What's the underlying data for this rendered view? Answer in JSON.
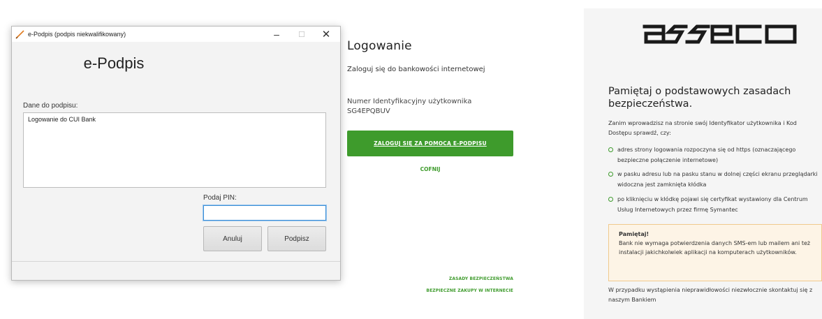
{
  "dialog": {
    "window_title": "e-Podpis (podpis niekwalifikowany)",
    "controls": {
      "minimize": "–",
      "maximize": "☐",
      "close": "✕"
    },
    "heading": "e-Podpis",
    "data_label": "Dane do podpisu:",
    "data_value": "Logowanie do CUI Bank",
    "pin_label": "Podaj PIN:",
    "pin_value": "",
    "cancel_label": "Anuluj",
    "sign_label": "Podpisz"
  },
  "login": {
    "title": "Logowanie",
    "subtitle": "Zaloguj się do bankowości internetowej",
    "user_id_label": "Numer Identyfikacyjny użytkownika",
    "user_id_value": "SG4EPQBUV",
    "login_button": "ZALOGUJ SIĘ ZA POMOCĄ E-PODPISU",
    "back_link": "COFNIJ",
    "footer_links": [
      "ZASADY BEZPIECZEŃSTWA",
      "BEZPIECZNE ZAKUPY W INTERNECIE"
    ]
  },
  "info": {
    "logo_text": "asseco",
    "heading": "Pamiętaj o podstawowych zasadach bezpieczeństwa.",
    "intro": "Zanim wprowadzisz na stronie swój Identyfikator użytkownika i Kod Dostępu sprawdź, czy:",
    "bullets": [
      "adres strony logowania rozpoczyna się od https (oznaczającego bezpieczne połączenie internetowe)",
      "w pasku adresu lub na pasku stanu w dolnej części ekranu przeglądarki widoczna jest zamknięta kłódka",
      "po kliknięciu w kłódkę pojawi się certyfikat wystawiony dla Centrum Usług Internetowych przez firmę Symantec"
    ],
    "note_title": "Pamiętaj!",
    "note_text": "Bank nie wymaga potwierdzenia danych SMS-em lub mailem ani też instalacji jakichkolwiek aplikacji na komputerach użytkowników.",
    "footer": "W przypadku wystąpienia nieprawidłowości niezwłocznie skontaktuj się z naszym Bankiem"
  },
  "colors": {
    "accent": "#3e9b2c",
    "note_bg": "#fdf4e6",
    "note_border": "#f0c98d"
  }
}
